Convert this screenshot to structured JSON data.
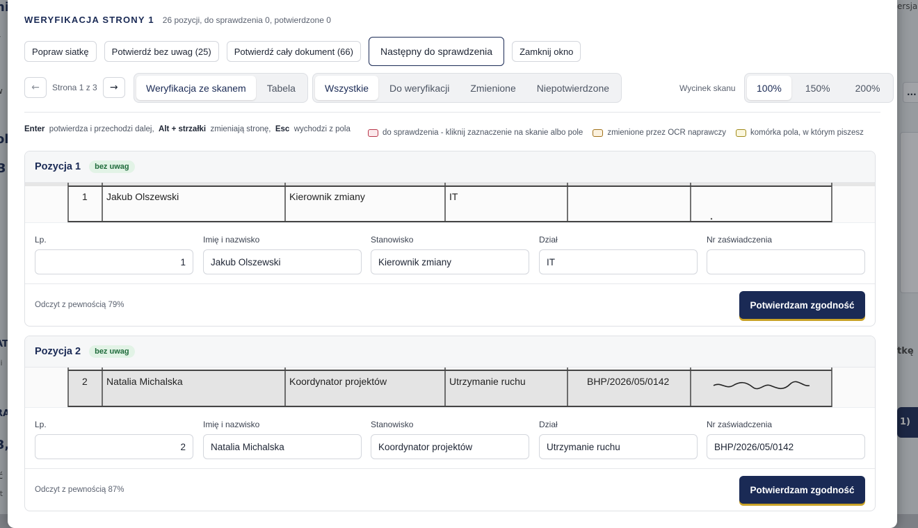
{
  "background": {
    "left_fragments": [
      "ni",
      "y",
      "w",
      "ol",
      "3",
      "AT",
      "vi",
      "RA",
      "3,",
      "Ić",
      "st"
    ],
    "right_fragments": [
      "ersja 1",
      "...",
      "tkę",
      "1)"
    ]
  },
  "modal": {
    "title": "WERYFIKACJA STRONY 1",
    "subtitle": "26 pozycji, do sprawdzenia 0, potwierdzone 0",
    "actions": {
      "fix_grid": "Popraw siatkę",
      "confirm_no_remarks": "Potwierdź bez uwag (25)",
      "confirm_document": "Potwierdź cały dokument (66)",
      "next_to_check": "Następny do sprawdzenia",
      "close_window": "Zamknij okno"
    },
    "pager": {
      "prev": "←",
      "next": "→",
      "label": "Strona 1 z 3"
    },
    "view_modes": {
      "scan": "Weryfikacja ze skanem",
      "table": "Tabela"
    },
    "filters": {
      "all": "Wszystkie",
      "to_verify": "Do weryfikacji",
      "changed": "Zmienione",
      "unconfirmed": "Niepotwierdzone"
    },
    "zoom": {
      "label": "Wycinek skanu",
      "z100": "100%",
      "z150": "150%",
      "z200": "200%"
    },
    "hints": {
      "enter_key": "Enter",
      "enter_text": "potwierdza i przechodzi dalej,",
      "alt_key": "Alt + strzałki",
      "alt_text": "zmieniają stronę,",
      "esc_key": "Esc",
      "esc_text": "wychodzi z pola"
    },
    "legend": [
      {
        "label": "do sprawdzenia - kliknij zaznaczenie na skanie albo pole",
        "color": "#b8374a",
        "fill": "#fbe9ec"
      },
      {
        "label": "zmienione przez OCR naprawczy",
        "color": "#a0701a",
        "fill": "#fbf1de"
      },
      {
        "label": "komórka pola, w którym piszesz",
        "color": "#a08a1a",
        "fill": "#fbf7de"
      }
    ],
    "field_labels": {
      "lp": "Lp.",
      "name": "Imię i nazwisko",
      "position": "Stanowisko",
      "dept": "Dział",
      "cert": "Nr zaświadczenia"
    },
    "confirm_label": "Potwierdzam zgodność",
    "positions": [
      {
        "title": "Pozycja 1",
        "badge": "bez uwag",
        "scan": {
          "lp": "1",
          "name": "Jakub Olszewski",
          "position": "Kierownik zmiany",
          "dept": "IT",
          "cert": ""
        },
        "values": {
          "lp": "1",
          "name": "Jakub Olszewski",
          "position": "Kierownik zmiany",
          "dept": "IT",
          "cert": ""
        },
        "confidence": "Odczyt z pewnością 79%"
      },
      {
        "title": "Pozycja 2",
        "badge": "bez uwag",
        "scan": {
          "lp": "2",
          "name": "Natalia Michalska",
          "position": "Koordynator projektów",
          "dept": "Utrzymanie ruchu",
          "cert": "BHP/2026/05/0142"
        },
        "values": {
          "lp": "2",
          "name": "Natalia Michalska",
          "position": "Koordynator projektów",
          "dept": "Utrzymanie ruchu",
          "cert": "BHP/2026/05/0142"
        },
        "confidence": "Odczyt z pewnością 87%"
      }
    ]
  }
}
